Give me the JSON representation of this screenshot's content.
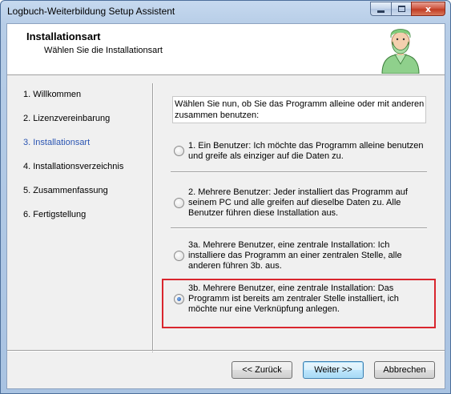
{
  "window": {
    "title": "Logbuch-Weiterbildung Setup Assistent",
    "close_glyph": "x"
  },
  "header": {
    "title": "Installationsart",
    "subtitle": "Wählen Sie die Installationsart",
    "icon": "surgeon-icon"
  },
  "steps": [
    {
      "label": "1. Willkommen",
      "active": false
    },
    {
      "label": "2. Lizenzvereinbarung",
      "active": false
    },
    {
      "label": "3. Installationsart",
      "active": true
    },
    {
      "label": "4. Installationsverzeichnis",
      "active": false
    },
    {
      "label": "5. Zusammenfassung",
      "active": false
    },
    {
      "label": "6. Fertigstellung",
      "active": false
    }
  ],
  "question": "Wählen Sie nun, ob Sie das Programm alleine oder mit anderen zusammen benutzen:",
  "options": [
    {
      "text": "1. Ein Benutzer: Ich möchte das Programm alleine benutzen und greife als einziger auf die Daten zu.",
      "checked": false
    },
    {
      "text": "2. Mehrere Benutzer: Jeder installiert das Programm auf seinem PC und alle greifen auf dieselbe Daten zu. Alle Benutzer führen diese Installation aus.",
      "checked": false
    },
    {
      "text": "3a. Mehrere Benutzer, eine zentrale Installation: Ich installiere das Programm an einer zentralen Stelle, alle anderen führen 3b. aus.",
      "checked": false
    },
    {
      "text": "3b. Mehrere Benutzer, eine zentrale Installation: Das Programm ist bereits am zentraler Stelle installiert, ich möchte nur eine Verknüpfung anlegen.",
      "checked": true
    }
  ],
  "buttons": {
    "back": "<< Zurück",
    "next": "Weiter >>",
    "cancel": "Abbrechen"
  },
  "colors": {
    "highlight": "#d9262e",
    "active_step": "#2b55b2"
  }
}
